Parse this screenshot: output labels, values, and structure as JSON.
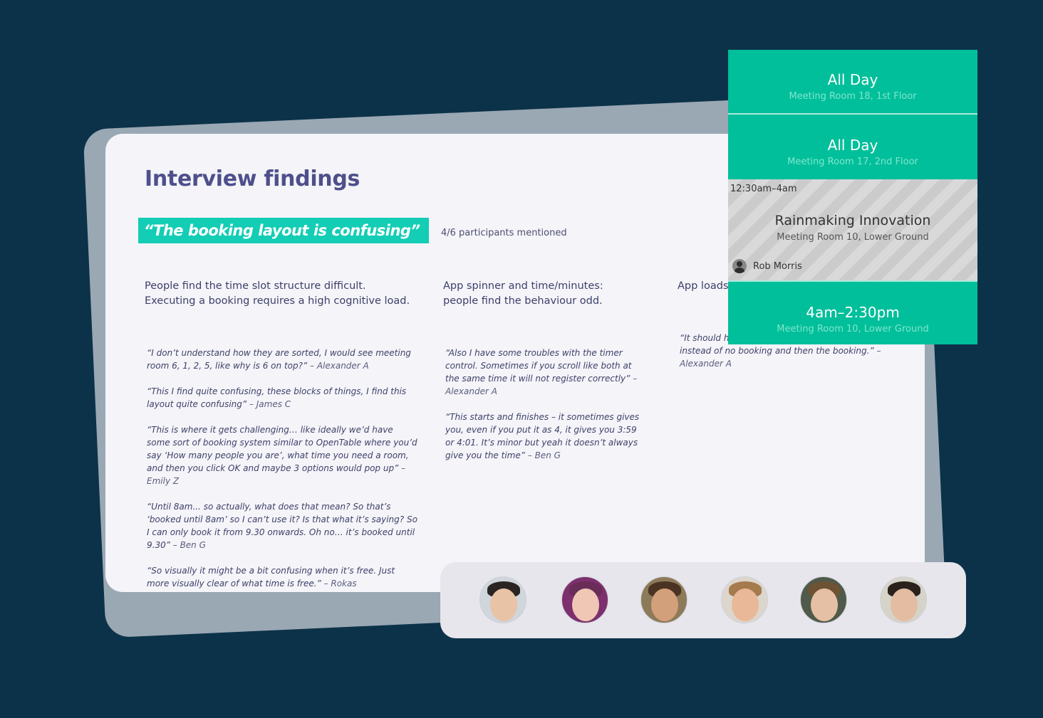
{
  "findings": {
    "title": "Interview findings",
    "highlight": "“The booking layout is confusing”",
    "mentions": "4/6 participants mentioned",
    "columns": [
      {
        "heading_line1": "People find the time slot structure difficult.",
        "heading_line2": "Executing a booking requires a high cognitive load.",
        "quotes": [
          {
            "text": "“I don’t understand how they are sorted, I would see meeting room 6, 1, 2, 5, like why is 6 on top?”",
            "by": " – Alexander A"
          },
          {
            "text": "“This I find quite confusing, these blocks of things, I find this layout quite confusing”",
            "by": " – James C"
          },
          {
            "text": "“This is where it gets challenging… like ideally we’d have some sort of booking system similar to OpenTable where you’d say ‘How many people you are’, what time you need a room, and then you click OK and maybe 3 options would pop up”",
            "by": " – Emily Z"
          },
          {
            "text": "“Until 8am... so actually, what does that mean? So that’s ‘booked until 8am’ so I can’t use it? Is that what it’s saying? So I can only book it from 9.30 onwards. Oh no… it’s booked until 9.30”",
            "by": " – Ben G"
          },
          {
            "text": "“So visually it might be a bit confusing when it’s free. Just more visually clear of what time is free.”",
            "by": " – Rokas"
          }
        ]
      },
      {
        "heading_line1": "App spinner and time/minutes:",
        "heading_line2": "people find the behaviour odd.",
        "quotes": [
          {
            "text": "“Also I have some troubles with the timer control. Sometimes if you scroll like both at the same time it will not register correctly”",
            "by": " – Alexander A"
          },
          {
            "text": "“This starts and finishes – it sometimes gives you, even if you put it as 4, it gives you 3:59 or 4:01. It’s minor but yeah it doesn’t always give you the time”",
            "by": " – Ben G"
          }
        ]
      },
      {
        "heading_line1": "App loads",
        "heading_line2": "",
        "quotes": [
          {
            "text": "“It should have shown me the booking right away instead of no booking and then the booking.”",
            "by": " – Alexander A"
          }
        ]
      }
    ]
  },
  "booking": {
    "slots": [
      {
        "time": "All Day",
        "room": "Meeting Room 18, 1st Floor"
      },
      {
        "time": "All Day",
        "room": "Meeting Room 17, 2nd Floor"
      },
      {
        "time": "4am–2:30pm",
        "room": "Meeting Room 10, Lower Ground"
      }
    ],
    "busy": {
      "range": "12:30am–4am",
      "name": "Rainmaking Innovation",
      "room": "Meeting Room 10, Lower Ground",
      "person": "Rob Morris"
    }
  },
  "participants": [
    {
      "name": "participant-1",
      "skin": "#e9c3a6",
      "hair": "#2a2522",
      "bg": "#cfd6dc"
    },
    {
      "name": "participant-2",
      "skin": "#efc7b4",
      "hair": "#6a2d58",
      "bg": "#7d2f6e"
    },
    {
      "name": "participant-3",
      "skin": "#d3a07c",
      "hair": "#4a3322",
      "bg": "#8d7a58"
    },
    {
      "name": "participant-4",
      "skin": "#e9b898",
      "hair": "#a57a4c",
      "bg": "#dcd6cc"
    },
    {
      "name": "participant-5",
      "skin": "#e6c0a4",
      "hair": "#6d5234",
      "bg": "#4f5a4b"
    },
    {
      "name": "participant-6",
      "skin": "#e4bca2",
      "hair": "#2a211c",
      "bg": "#d6d3c9"
    }
  ],
  "colors": {
    "background": "#0c3249",
    "accent": "#13cdb5",
    "slot_green": "#00bf9a",
    "title": "#4e4f8b"
  }
}
